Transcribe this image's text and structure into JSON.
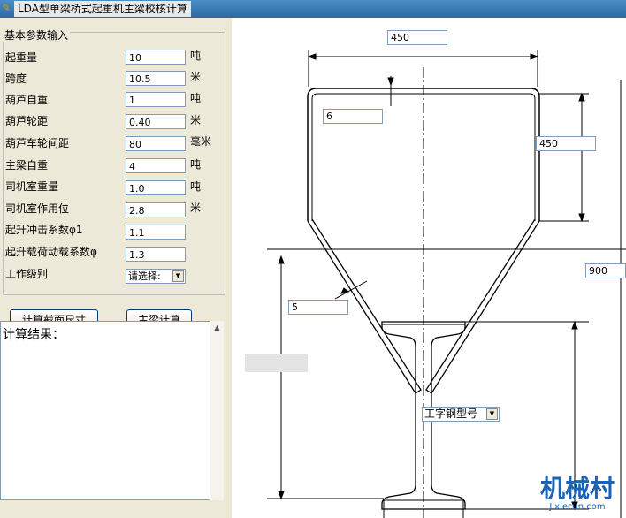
{
  "window": {
    "title": "LDA型单梁桥式起重机主梁校核计算"
  },
  "params": {
    "group_title": "基本参数输入",
    "rows": [
      {
        "label": "起重量",
        "value": "10",
        "unit": "吨"
      },
      {
        "label": "跨度",
        "value": "10.5",
        "unit": "米"
      },
      {
        "label": "葫芦自重",
        "value": "1",
        "unit": "吨"
      },
      {
        "label": "葫芦轮距",
        "value": "0.40",
        "unit": "米"
      },
      {
        "label": "葫芦车轮间距",
        "value": "80",
        "unit": "毫米"
      },
      {
        "label": "主梁自重",
        "value": "4",
        "unit": "吨"
      },
      {
        "label": "司机室重量",
        "value": "1.0",
        "unit": "吨"
      },
      {
        "label": "司机室作用位",
        "value": "2.8",
        "unit": "米"
      },
      {
        "label": "起升冲击系数φ1",
        "value": "1.1",
        "unit": ""
      },
      {
        "label": "起升载荷动载系数φ",
        "value": "1.3",
        "unit": ""
      }
    ],
    "work_level": {
      "label": "工作级别",
      "selected": "请选择:"
    }
  },
  "buttons": {
    "calc_section": "计算截面尺寸",
    "calc_beam": "主梁计算"
  },
  "result": {
    "label": "计算结果："
  },
  "drawing": {
    "top_width": "450",
    "top_plate_thickness": "6",
    "box_height": "450",
    "total_height": "900",
    "web_thickness": "5",
    "i_beam_select": "工字钢型号"
  },
  "watermark": {
    "main": "机械村",
    "sub": "Jixiecun.com",
    "color": "#1a63b5"
  },
  "colors": {
    "titlebar": "#2c6aa4",
    "panel": "#ece9d8",
    "input_border": "#7f9db9"
  }
}
